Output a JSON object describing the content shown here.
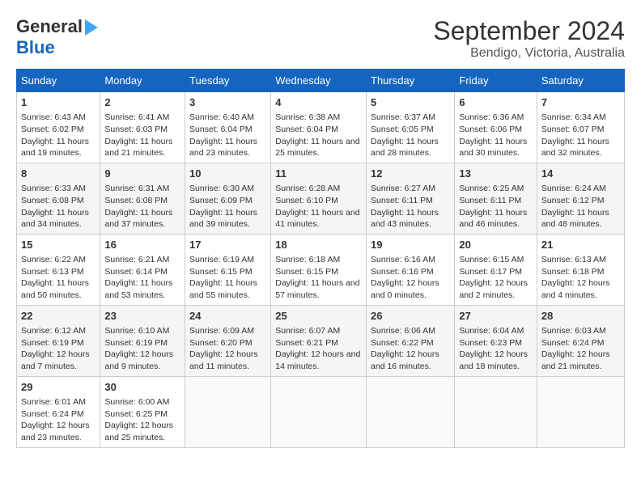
{
  "header": {
    "logo_line1": "General",
    "logo_line2": "Blue",
    "title": "September 2024",
    "subtitle": "Bendigo, Victoria, Australia"
  },
  "days_of_week": [
    "Sunday",
    "Monday",
    "Tuesday",
    "Wednesday",
    "Thursday",
    "Friday",
    "Saturday"
  ],
  "weeks": [
    [
      {
        "day": "1",
        "sunrise": "Sunrise: 6:43 AM",
        "sunset": "Sunset: 6:02 PM",
        "daylight": "Daylight: 11 hours and 19 minutes."
      },
      {
        "day": "2",
        "sunrise": "Sunrise: 6:41 AM",
        "sunset": "Sunset: 6:03 PM",
        "daylight": "Daylight: 11 hours and 21 minutes."
      },
      {
        "day": "3",
        "sunrise": "Sunrise: 6:40 AM",
        "sunset": "Sunset: 6:04 PM",
        "daylight": "Daylight: 11 hours and 23 minutes."
      },
      {
        "day": "4",
        "sunrise": "Sunrise: 6:38 AM",
        "sunset": "Sunset: 6:04 PM",
        "daylight": "Daylight: 11 hours and 25 minutes."
      },
      {
        "day": "5",
        "sunrise": "Sunrise: 6:37 AM",
        "sunset": "Sunset: 6:05 PM",
        "daylight": "Daylight: 11 hours and 28 minutes."
      },
      {
        "day": "6",
        "sunrise": "Sunrise: 6:36 AM",
        "sunset": "Sunset: 6:06 PM",
        "daylight": "Daylight: 11 hours and 30 minutes."
      },
      {
        "day": "7",
        "sunrise": "Sunrise: 6:34 AM",
        "sunset": "Sunset: 6:07 PM",
        "daylight": "Daylight: 11 hours and 32 minutes."
      }
    ],
    [
      {
        "day": "8",
        "sunrise": "Sunrise: 6:33 AM",
        "sunset": "Sunset: 6:08 PM",
        "daylight": "Daylight: 11 hours and 34 minutes."
      },
      {
        "day": "9",
        "sunrise": "Sunrise: 6:31 AM",
        "sunset": "Sunset: 6:08 PM",
        "daylight": "Daylight: 11 hours and 37 minutes."
      },
      {
        "day": "10",
        "sunrise": "Sunrise: 6:30 AM",
        "sunset": "Sunset: 6:09 PM",
        "daylight": "Daylight: 11 hours and 39 minutes."
      },
      {
        "day": "11",
        "sunrise": "Sunrise: 6:28 AM",
        "sunset": "Sunset: 6:10 PM",
        "daylight": "Daylight: 11 hours and 41 minutes."
      },
      {
        "day": "12",
        "sunrise": "Sunrise: 6:27 AM",
        "sunset": "Sunset: 6:11 PM",
        "daylight": "Daylight: 11 hours and 43 minutes."
      },
      {
        "day": "13",
        "sunrise": "Sunrise: 6:25 AM",
        "sunset": "Sunset: 6:11 PM",
        "daylight": "Daylight: 11 hours and 46 minutes."
      },
      {
        "day": "14",
        "sunrise": "Sunrise: 6:24 AM",
        "sunset": "Sunset: 6:12 PM",
        "daylight": "Daylight: 11 hours and 48 minutes."
      }
    ],
    [
      {
        "day": "15",
        "sunrise": "Sunrise: 6:22 AM",
        "sunset": "Sunset: 6:13 PM",
        "daylight": "Daylight: 11 hours and 50 minutes."
      },
      {
        "day": "16",
        "sunrise": "Sunrise: 6:21 AM",
        "sunset": "Sunset: 6:14 PM",
        "daylight": "Daylight: 11 hours and 53 minutes."
      },
      {
        "day": "17",
        "sunrise": "Sunrise: 6:19 AM",
        "sunset": "Sunset: 6:15 PM",
        "daylight": "Daylight: 11 hours and 55 minutes."
      },
      {
        "day": "18",
        "sunrise": "Sunrise: 6:18 AM",
        "sunset": "Sunset: 6:15 PM",
        "daylight": "Daylight: 11 hours and 57 minutes."
      },
      {
        "day": "19",
        "sunrise": "Sunrise: 6:16 AM",
        "sunset": "Sunset: 6:16 PM",
        "daylight": "Daylight: 12 hours and 0 minutes."
      },
      {
        "day": "20",
        "sunrise": "Sunrise: 6:15 AM",
        "sunset": "Sunset: 6:17 PM",
        "daylight": "Daylight: 12 hours and 2 minutes."
      },
      {
        "day": "21",
        "sunrise": "Sunrise: 6:13 AM",
        "sunset": "Sunset: 6:18 PM",
        "daylight": "Daylight: 12 hours and 4 minutes."
      }
    ],
    [
      {
        "day": "22",
        "sunrise": "Sunrise: 6:12 AM",
        "sunset": "Sunset: 6:19 PM",
        "daylight": "Daylight: 12 hours and 7 minutes."
      },
      {
        "day": "23",
        "sunrise": "Sunrise: 6:10 AM",
        "sunset": "Sunset: 6:19 PM",
        "daylight": "Daylight: 12 hours and 9 minutes."
      },
      {
        "day": "24",
        "sunrise": "Sunrise: 6:09 AM",
        "sunset": "Sunset: 6:20 PM",
        "daylight": "Daylight: 12 hours and 11 minutes."
      },
      {
        "day": "25",
        "sunrise": "Sunrise: 6:07 AM",
        "sunset": "Sunset: 6:21 PM",
        "daylight": "Daylight: 12 hours and 14 minutes."
      },
      {
        "day": "26",
        "sunrise": "Sunrise: 6:06 AM",
        "sunset": "Sunset: 6:22 PM",
        "daylight": "Daylight: 12 hours and 16 minutes."
      },
      {
        "day": "27",
        "sunrise": "Sunrise: 6:04 AM",
        "sunset": "Sunset: 6:23 PM",
        "daylight": "Daylight: 12 hours and 18 minutes."
      },
      {
        "day": "28",
        "sunrise": "Sunrise: 6:03 AM",
        "sunset": "Sunset: 6:24 PM",
        "daylight": "Daylight: 12 hours and 21 minutes."
      }
    ],
    [
      {
        "day": "29",
        "sunrise": "Sunrise: 6:01 AM",
        "sunset": "Sunset: 6:24 PM",
        "daylight": "Daylight: 12 hours and 23 minutes."
      },
      {
        "day": "30",
        "sunrise": "Sunrise: 6:00 AM",
        "sunset": "Sunset: 6:25 PM",
        "daylight": "Daylight: 12 hours and 25 minutes."
      },
      null,
      null,
      null,
      null,
      null
    ]
  ]
}
